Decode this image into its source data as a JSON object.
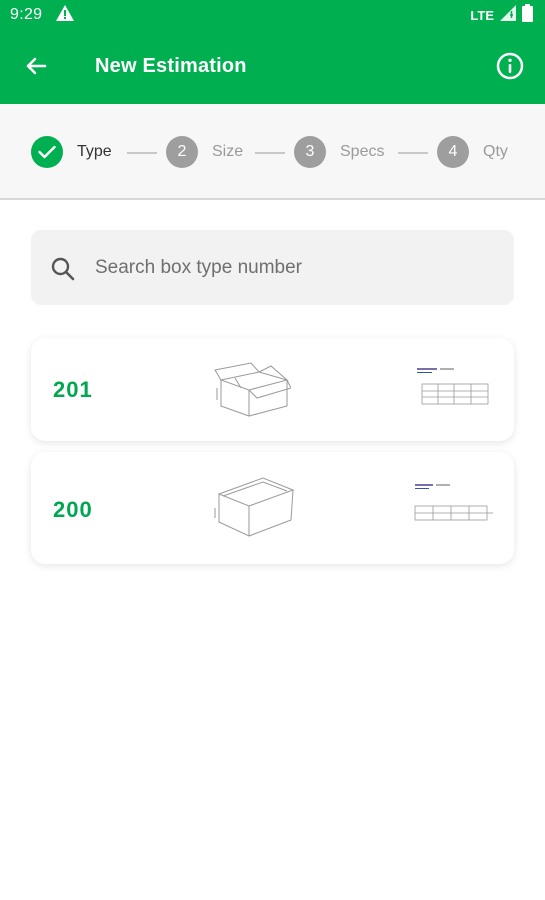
{
  "status_bar": {
    "time": "9:29",
    "network": "LTE",
    "icons": [
      "warning-icon",
      "signal-icon",
      "battery-icon"
    ]
  },
  "app_bar": {
    "title": "New Estimation",
    "back_icon": "arrow-left-icon",
    "info_icon": "info-icon"
  },
  "stepper": {
    "steps": [
      {
        "number": "",
        "label": "Type",
        "state": "done"
      },
      {
        "number": "2",
        "label": "Size",
        "state": "pending"
      },
      {
        "number": "3",
        "label": "Specs",
        "state": "pending"
      },
      {
        "number": "4",
        "label": "Qty",
        "state": "pending"
      }
    ]
  },
  "search": {
    "placeholder": "Search box type number",
    "value": ""
  },
  "box_types": [
    {
      "number": "201"
    },
    {
      "number": "200"
    }
  ],
  "colors": {
    "primary": "#00b050",
    "box_number": "#00a650",
    "pending_step": "#9e9e9e"
  }
}
